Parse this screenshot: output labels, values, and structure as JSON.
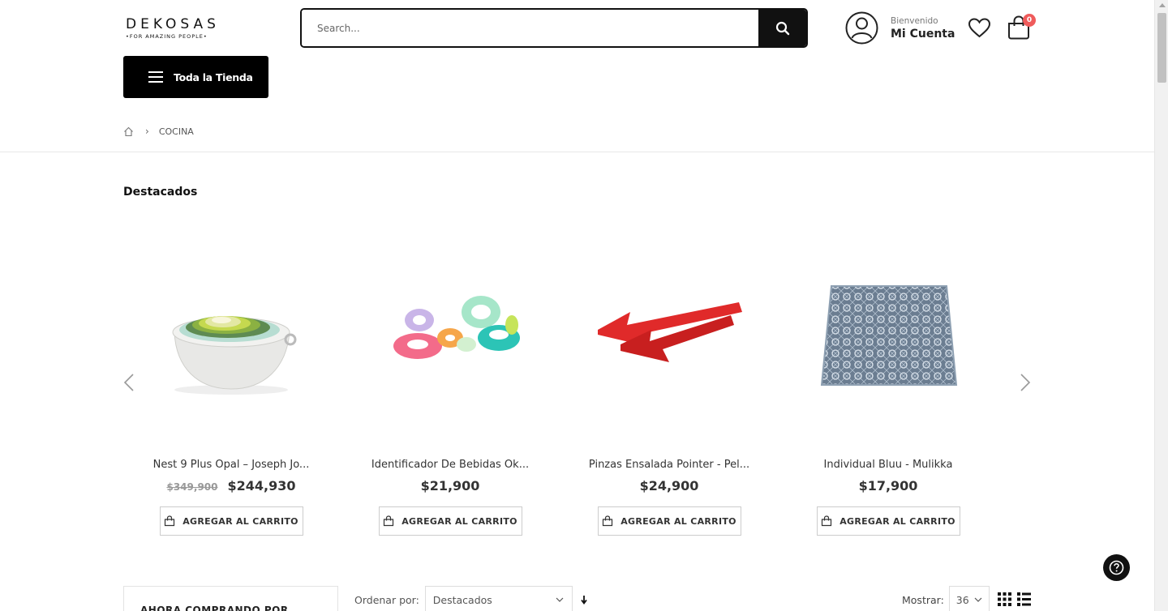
{
  "header": {
    "logo": {
      "word": "DEKOSAS",
      "tagline": "•FOR AMAZING PEOPLE•"
    },
    "search": {
      "placeholder": "Search..."
    },
    "account": {
      "welcome": "Bienvenido",
      "name": "Mi Cuenta"
    },
    "cart": {
      "count": "0"
    },
    "store_button": "Toda la Tienda"
  },
  "breadcrumb": {
    "current": "COCINA"
  },
  "featured": {
    "title": "Destacados",
    "products": [
      {
        "name": "Nest 9 Plus Opal – Joseph Jo...",
        "old_price": "$349,900",
        "price": "$244,930",
        "button": "AGREGAR AL CARRITO",
        "image": "nesting-bowls"
      },
      {
        "name": "Identificador De Bebidas Ok...",
        "old_price": "",
        "price": "$21,900",
        "button": "AGREGAR AL CARRITO",
        "image": "drink-markers"
      },
      {
        "name": "Pinzas Ensalada Pointer - Pel...",
        "old_price": "",
        "price": "$24,900",
        "button": "AGREGAR AL CARRITO",
        "image": "salad-tongs"
      },
      {
        "name": "Individual Bluu - Mulikka",
        "old_price": "",
        "price": "$17,900",
        "button": "AGREGAR AL CARRITO",
        "image": "placemat"
      }
    ]
  },
  "sidebar": {
    "title": "AHORA COMPRANDO POR"
  },
  "toolbar": {
    "sort_label": "Ordenar por:",
    "sort_value": "Destacados",
    "show_label": "Mostrar:",
    "show_value": "36"
  },
  "colors": {
    "accent": "#111111",
    "badge": "#ef5b5b"
  }
}
